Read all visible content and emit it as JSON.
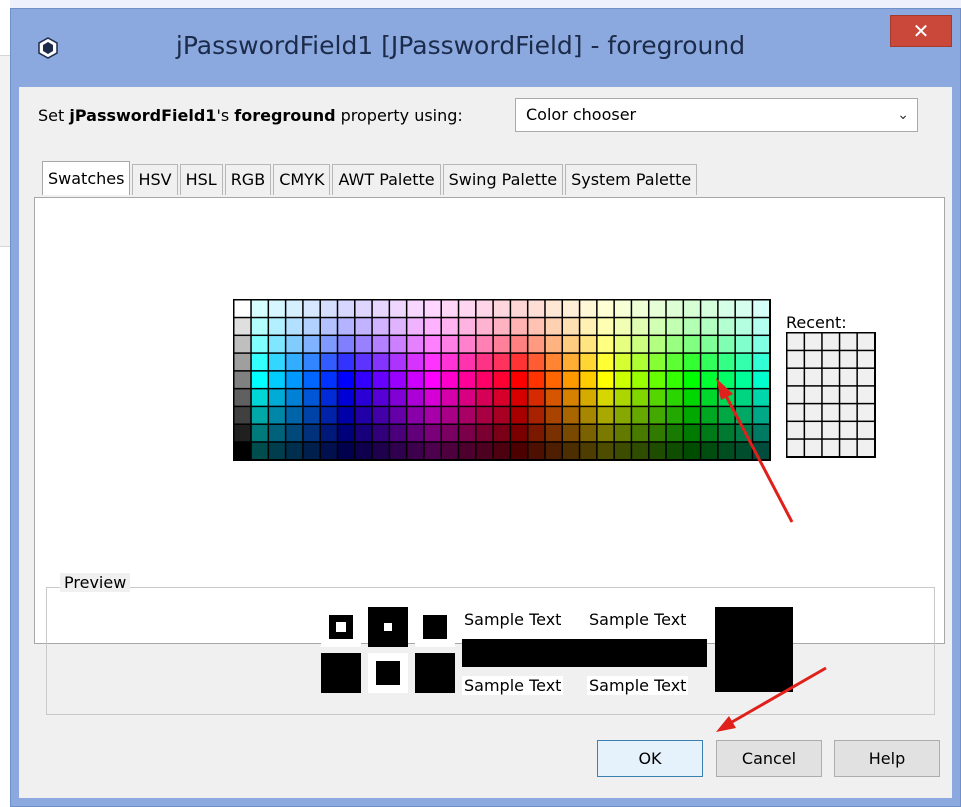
{
  "dialog": {
    "title": "jPasswordField1 [JPasswordField] - foreground",
    "close_glyph": "✕",
    "property_prefix": "Set ",
    "component_name": "jPasswordField1",
    "property_middle": "'s ",
    "property_name": "foreground",
    "property_suffix": " property using:",
    "mode_select": {
      "selected": "Color chooser",
      "icon": "chevron-down-icon"
    }
  },
  "tabs": [
    {
      "label": "Swatches",
      "active": true
    },
    {
      "label": "HSV",
      "active": false
    },
    {
      "label": "HSL",
      "active": false
    },
    {
      "label": "RGB",
      "active": false
    },
    {
      "label": "CMYK",
      "active": false
    },
    {
      "label": "AWT Palette",
      "active": false
    },
    {
      "label": "Swing Palette",
      "active": false
    },
    {
      "label": "System Palette",
      "active": false
    }
  ],
  "swatches": {
    "recent_label": "Recent:"
  },
  "preview": {
    "label": "Preview",
    "sample_text_1": "Sample Text",
    "sample_text_2": "Sample Text",
    "sample_text_3": "Sample Text",
    "sample_text_4": "Sample Text",
    "selected_color": "#000000"
  },
  "buttons": {
    "ok": "OK",
    "cancel": "Cancel",
    "help": "Help"
  },
  "colors": {
    "title_bar": "#8ba9df",
    "close_button": "#c9483a",
    "annotation_arrow": "#e0201a"
  }
}
